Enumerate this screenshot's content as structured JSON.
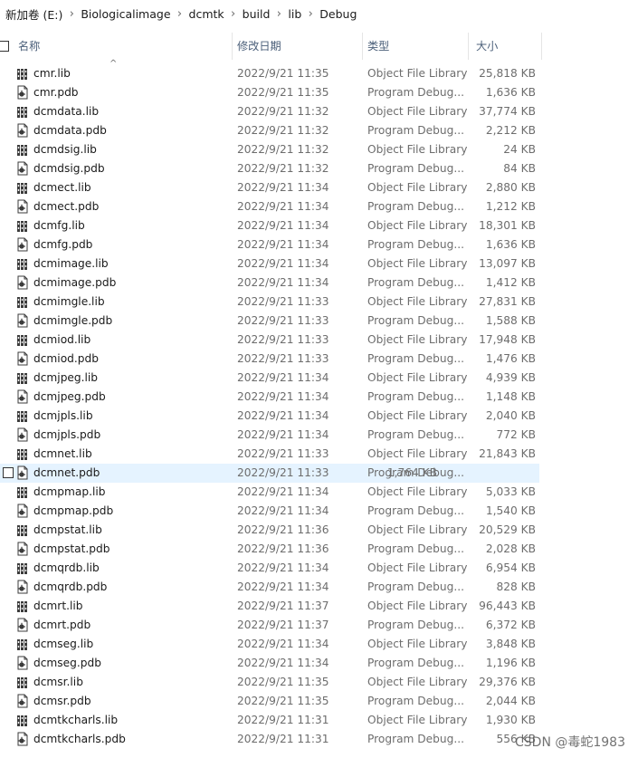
{
  "breadcrumb": [
    "新加卷 (E:)",
    "Biologicalimage",
    "dcmtk",
    "build",
    "lib",
    "Debug"
  ],
  "columns": {
    "name": "名称",
    "date": "修改日期",
    "type": "类型",
    "size": "大小"
  },
  "sort_indicator": "^",
  "hovered_index": 21,
  "files": [
    {
      "name": "cmr.lib",
      "date": "2022/9/21 11:35",
      "type": "Object File Library",
      "size": "25,818 KB",
      "icon": "library-file-icon"
    },
    {
      "name": "cmr.pdb",
      "date": "2022/9/21 11:35",
      "type": "Program Debug...",
      "size": "1,636 KB",
      "icon": "debug-file-icon"
    },
    {
      "name": "dcmdata.lib",
      "date": "2022/9/21 11:32",
      "type": "Object File Library",
      "size": "37,774 KB",
      "icon": "library-file-icon"
    },
    {
      "name": "dcmdata.pdb",
      "date": "2022/9/21 11:32",
      "type": "Program Debug...",
      "size": "2,212 KB",
      "icon": "debug-file-icon"
    },
    {
      "name": "dcmdsig.lib",
      "date": "2022/9/21 11:32",
      "type": "Object File Library",
      "size": "24 KB",
      "icon": "library-file-icon"
    },
    {
      "name": "dcmdsig.pdb",
      "date": "2022/9/21 11:32",
      "type": "Program Debug...",
      "size": "84 KB",
      "icon": "debug-file-icon"
    },
    {
      "name": "dcmect.lib",
      "date": "2022/9/21 11:34",
      "type": "Object File Library",
      "size": "2,880 KB",
      "icon": "library-file-icon"
    },
    {
      "name": "dcmect.pdb",
      "date": "2022/9/21 11:34",
      "type": "Program Debug...",
      "size": "1,212 KB",
      "icon": "debug-file-icon"
    },
    {
      "name": "dcmfg.lib",
      "date": "2022/9/21 11:34",
      "type": "Object File Library",
      "size": "18,301 KB",
      "icon": "library-file-icon"
    },
    {
      "name": "dcmfg.pdb",
      "date": "2022/9/21 11:34",
      "type": "Program Debug...",
      "size": "1,636 KB",
      "icon": "debug-file-icon"
    },
    {
      "name": "dcmimage.lib",
      "date": "2022/9/21 11:34",
      "type": "Object File Library",
      "size": "13,097 KB",
      "icon": "library-file-icon"
    },
    {
      "name": "dcmimage.pdb",
      "date": "2022/9/21 11:34",
      "type": "Program Debug...",
      "size": "1,412 KB",
      "icon": "debug-file-icon"
    },
    {
      "name": "dcmimgle.lib",
      "date": "2022/9/21 11:33",
      "type": "Object File Library",
      "size": "27,831 KB",
      "icon": "library-file-icon"
    },
    {
      "name": "dcmimgle.pdb",
      "date": "2022/9/21 11:33",
      "type": "Program Debug...",
      "size": "1,588 KB",
      "icon": "debug-file-icon"
    },
    {
      "name": "dcmiod.lib",
      "date": "2022/9/21 11:33",
      "type": "Object File Library",
      "size": "17,948 KB",
      "icon": "library-file-icon"
    },
    {
      "name": "dcmiod.pdb",
      "date": "2022/9/21 11:33",
      "type": "Program Debug...",
      "size": "1,476 KB",
      "icon": "debug-file-icon"
    },
    {
      "name": "dcmjpeg.lib",
      "date": "2022/9/21 11:34",
      "type": "Object File Library",
      "size": "4,939 KB",
      "icon": "library-file-icon"
    },
    {
      "name": "dcmjpeg.pdb",
      "date": "2022/9/21 11:34",
      "type": "Program Debug...",
      "size": "1,148 KB",
      "icon": "debug-file-icon"
    },
    {
      "name": "dcmjpls.lib",
      "date": "2022/9/21 11:34",
      "type": "Object File Library",
      "size": "2,040 KB",
      "icon": "library-file-icon"
    },
    {
      "name": "dcmjpls.pdb",
      "date": "2022/9/21 11:34",
      "type": "Program Debug...",
      "size": "772 KB",
      "icon": "debug-file-icon"
    },
    {
      "name": "dcmnet.lib",
      "date": "2022/9/21 11:33",
      "type": "Object File Library",
      "size": "21,843 KB",
      "icon": "library-file-icon"
    },
    {
      "name": "dcmnet.pdb",
      "date": "2022/9/21 11:33",
      "type": "Program Debug...",
      "size": "1,764 KB",
      "icon": "debug-file-icon"
    },
    {
      "name": "dcmpmap.lib",
      "date": "2022/9/21 11:34",
      "type": "Object File Library",
      "size": "5,033 KB",
      "icon": "library-file-icon"
    },
    {
      "name": "dcmpmap.pdb",
      "date": "2022/9/21 11:34",
      "type": "Program Debug...",
      "size": "1,540 KB",
      "icon": "debug-file-icon"
    },
    {
      "name": "dcmpstat.lib",
      "date": "2022/9/21 11:36",
      "type": "Object File Library",
      "size": "20,529 KB",
      "icon": "library-file-icon"
    },
    {
      "name": "dcmpstat.pdb",
      "date": "2022/9/21 11:36",
      "type": "Program Debug...",
      "size": "2,028 KB",
      "icon": "debug-file-icon"
    },
    {
      "name": "dcmqrdb.lib",
      "date": "2022/9/21 11:34",
      "type": "Object File Library",
      "size": "6,954 KB",
      "icon": "library-file-icon"
    },
    {
      "name": "dcmqrdb.pdb",
      "date": "2022/9/21 11:34",
      "type": "Program Debug...",
      "size": "828 KB",
      "icon": "debug-file-icon"
    },
    {
      "name": "dcmrt.lib",
      "date": "2022/9/21 11:37",
      "type": "Object File Library",
      "size": "96,443 KB",
      "icon": "library-file-icon"
    },
    {
      "name": "dcmrt.pdb",
      "date": "2022/9/21 11:37",
      "type": "Program Debug...",
      "size": "6,372 KB",
      "icon": "debug-file-icon"
    },
    {
      "name": "dcmseg.lib",
      "date": "2022/9/21 11:34",
      "type": "Object File Library",
      "size": "3,848 KB",
      "icon": "library-file-icon"
    },
    {
      "name": "dcmseg.pdb",
      "date": "2022/9/21 11:34",
      "type": "Program Debug...",
      "size": "1,196 KB",
      "icon": "debug-file-icon"
    },
    {
      "name": "dcmsr.lib",
      "date": "2022/9/21 11:35",
      "type": "Object File Library",
      "size": "29,376 KB",
      "icon": "library-file-icon"
    },
    {
      "name": "dcmsr.pdb",
      "date": "2022/9/21 11:35",
      "type": "Program Debug...",
      "size": "2,044 KB",
      "icon": "debug-file-icon"
    },
    {
      "name": "dcmtkcharls.lib",
      "date": "2022/9/21 11:31",
      "type": "Object File Library",
      "size": "1,930 KB",
      "icon": "library-file-icon"
    },
    {
      "name": "dcmtkcharls.pdb",
      "date": "2022/9/21 11:31",
      "type": "Program Debug...",
      "size": "556 KB",
      "icon": "debug-file-icon"
    }
  ],
  "watermark": "CSDN @毒蛇1983"
}
